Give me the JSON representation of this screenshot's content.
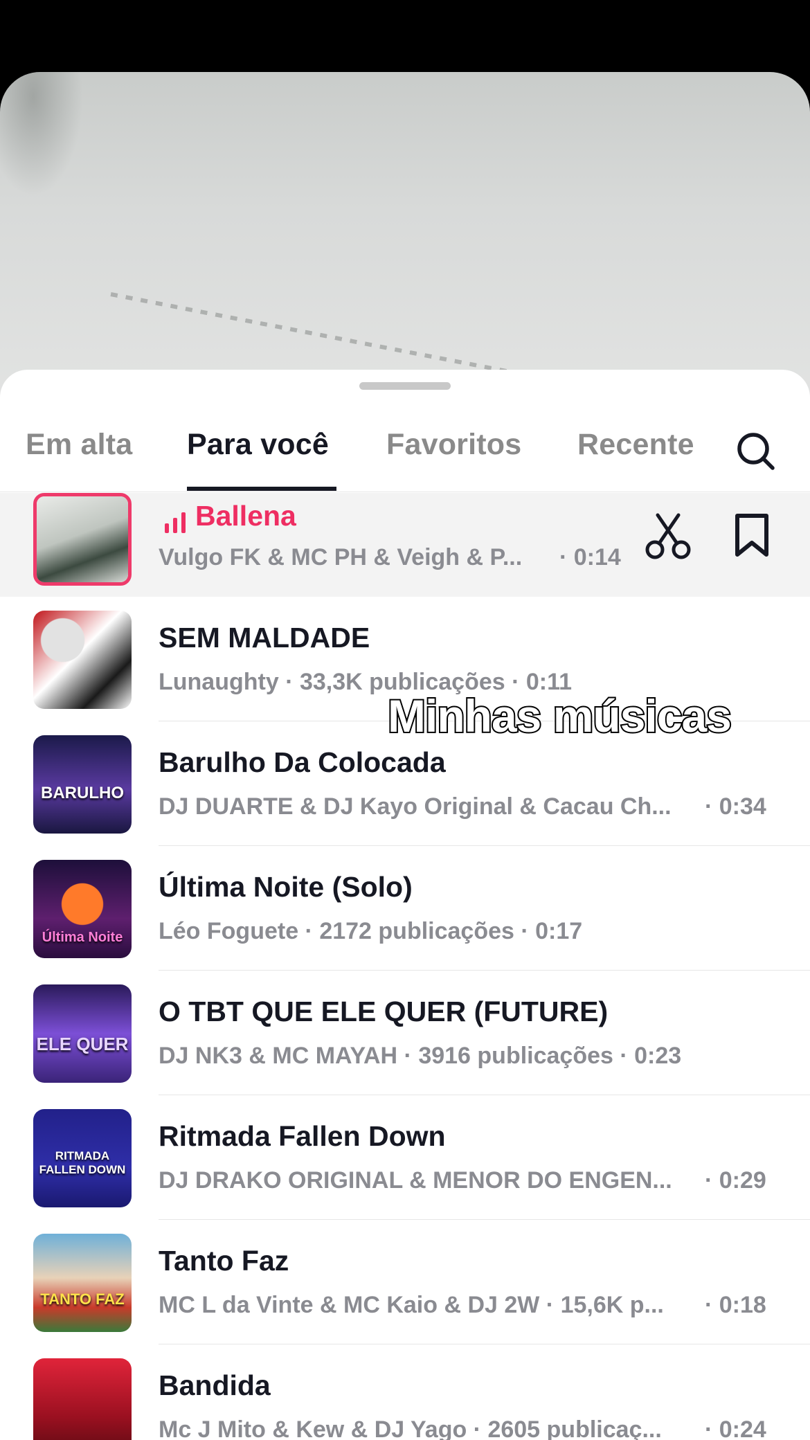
{
  "sheet": {
    "tabs": [
      "Em alta",
      "Para você",
      "Favoritos",
      "Recente"
    ],
    "active_tab": "Para você"
  },
  "overlay": {
    "caption": "Minhas músicas"
  },
  "colors": {
    "accent": "#ee2e62",
    "text": "#161823",
    "muted": "#8a8b91"
  },
  "tracks": [
    {
      "title": "Ballena",
      "meta": "Vulgo FK & MC PH & Veigh & P...",
      "duration": "· 0:14",
      "playing": true,
      "cover_text": ""
    },
    {
      "title": "SEM MALDADE",
      "meta": "Lunaughty · 33,3K publicações · 0:11",
      "duration": "",
      "cover_text": ""
    },
    {
      "title": "Barulho Da Colocada",
      "meta": "DJ DUARTE & DJ Kayo Original & Cacau Ch...",
      "duration": "· 0:34",
      "cover_text": "BARULHO"
    },
    {
      "title": "Última Noite (Solo)",
      "meta": "Léo Foguete · 2172 publicações · 0:17",
      "duration": "",
      "cover_text": "Última Noite"
    },
    {
      "title": "O TBT QUE ELE QUER (FUTURE)",
      "meta": "DJ NK3 & MC MAYAH · 3916 publicações · 0:23",
      "duration": "",
      "cover_text": "ELE QUER"
    },
    {
      "title": "Ritmada Fallen Down",
      "meta": "DJ DRAKO ORIGINAL & MENOR DO ENGEN...",
      "duration": "· 0:29",
      "cover_text": "RITMADA FALLEN DOWN"
    },
    {
      "title": "Tanto Faz",
      "meta": "MC L da Vinte & MC Kaio & DJ 2W · 15,6K p...",
      "duration": "· 0:18",
      "cover_text": "TANTO FAZ"
    },
    {
      "title": "Bandida",
      "meta": "Mc J Mito & Kew & DJ Yago · 2605 publicaç...",
      "duration": "· 0:24",
      "cover_text": ""
    }
  ],
  "icons": [
    "scissors-icon",
    "bookmark-icon",
    "search-icon",
    "playing-bars-icon"
  ]
}
